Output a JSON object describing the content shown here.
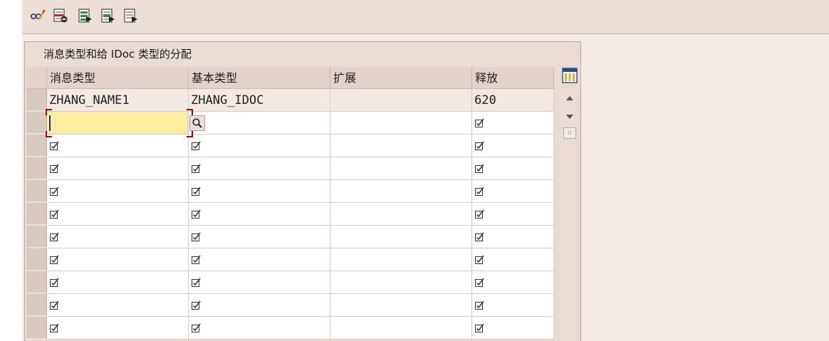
{
  "toolbar": {
    "buttons": [
      {
        "icon": "glasses-pencil-icon"
      },
      {
        "icon": "delete-row-icon"
      },
      {
        "icon": "select-all-icon"
      },
      {
        "icon": "select-block-icon"
      },
      {
        "icon": "deselect-all-icon"
      }
    ]
  },
  "panel": {
    "title": "消息类型和给 IDoc 类型的分配",
    "columns": [
      "消息类型",
      "基本类型",
      "扩展",
      "释放"
    ]
  },
  "rows": [
    {
      "message_type": "ZHANG_NAME1",
      "basic_type": "ZHANG_IDOC",
      "extension": "",
      "release": "620"
    }
  ],
  "colors": {
    "active_input": "#ffee9e",
    "focus_corners": "#b30000",
    "toolbar_bg": "#ecdfd8",
    "panel_bg": "#e8dcd5"
  }
}
